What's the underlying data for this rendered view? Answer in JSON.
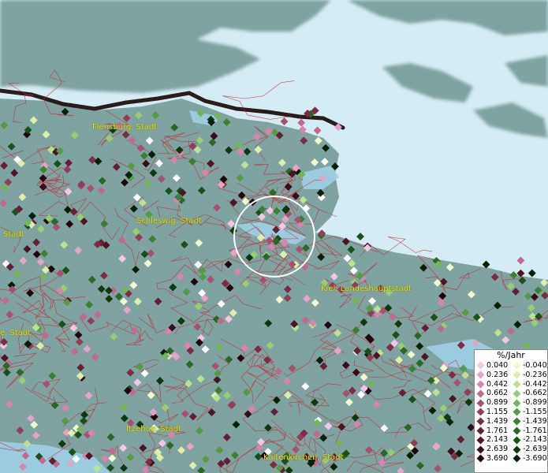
{
  "cities": [
    {
      "id": "flensburg",
      "label": "Flensburg, Stadt"
    },
    {
      "id": "schleswig",
      "label": "Schleswig, Stadt"
    },
    {
      "id": "kiel",
      "label": "Kiel, Landeshauptstadt"
    },
    {
      "id": "itzehoe",
      "label": "Itzehoe, Stadt"
    },
    {
      "id": "kaltenkirchen",
      "label": "Kaltenkirchen, Stadt"
    },
    {
      "id": "west1",
      "label": "Stadt"
    },
    {
      "id": "west2",
      "label": "e, Stadt"
    }
  ],
  "legend": {
    "title": "%/Jahr",
    "positive": [
      {
        "value": "0.040",
        "color": "#f3c6e4"
      },
      {
        "value": "0.236",
        "color": "#e7a2c8"
      },
      {
        "value": "0.442",
        "color": "#d785ad"
      },
      {
        "value": "0.662",
        "color": "#c06a8f"
      },
      {
        "value": "0.899",
        "color": "#a8506f"
      },
      {
        "value": "1.155",
        "color": "#913e58"
      },
      {
        "value": "1.439",
        "color": "#7c2d44"
      },
      {
        "value": "1.761",
        "color": "#641f33"
      },
      {
        "value": "2.143",
        "color": "#4d1424"
      },
      {
        "value": "2.639",
        "color": "#380c18"
      },
      {
        "value": "3.690",
        "color": "#22050b"
      }
    ],
    "negative": [
      {
        "value": "-0.040",
        "color": "#f1fbd0"
      },
      {
        "value": "-0.236",
        "color": "#dcefaf"
      },
      {
        "value": "-0.442",
        "color": "#bde193"
      },
      {
        "value": "-0.662",
        "color": "#98cc75"
      },
      {
        "value": "-0.899",
        "color": "#75b45e"
      },
      {
        "value": "-1.155",
        "color": "#549a48"
      },
      {
        "value": "-1.439",
        "color": "#3c8036"
      },
      {
        "value": "-1.761",
        "color": "#296827"
      },
      {
        "value": "-2.143",
        "color": "#1a501a"
      },
      {
        "value": "-2.639",
        "color": "#0e3810"
      },
      {
        "value": "-3.690",
        "color": "#052006"
      }
    ]
  },
  "colors": {
    "sea": "#d6ecf4",
    "land": "#7fa3a0",
    "border": "#2a1c1a",
    "districts": "#c8232e",
    "highlight": "#ffffff"
  }
}
